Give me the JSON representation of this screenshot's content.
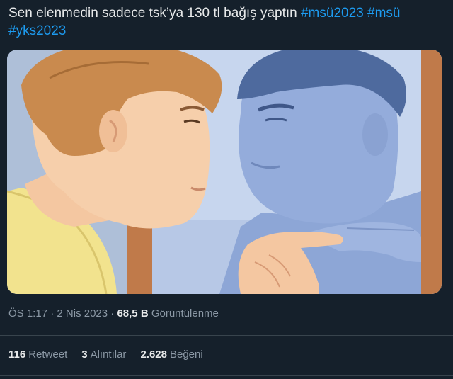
{
  "tweet": {
    "text_plain": "Sen elenmedin sadece tsk’ya 130 tl bağış yaptın ",
    "hashtags": [
      "#msü2023",
      "#msü",
      "#yks2023"
    ],
    "media_alt": "",
    "time": "ÖS 1:17",
    "date": "2 Nis 2023",
    "views_count": "68,5 B",
    "views_label": "Görüntülenme",
    "retweets_count": "116",
    "retweets_label": "Retweet",
    "quotes_count": "3",
    "quotes_label": "Alıntılar",
    "likes_count": "2.628",
    "likes_label": "Beğeni"
  },
  "colors": {
    "background": "#15202b",
    "text": "#e7e9ea",
    "hashtag": "#1d9bf0",
    "secondary": "#8b98a5",
    "divider": "#38444d"
  },
  "icons": [
    "meme-image"
  ]
}
